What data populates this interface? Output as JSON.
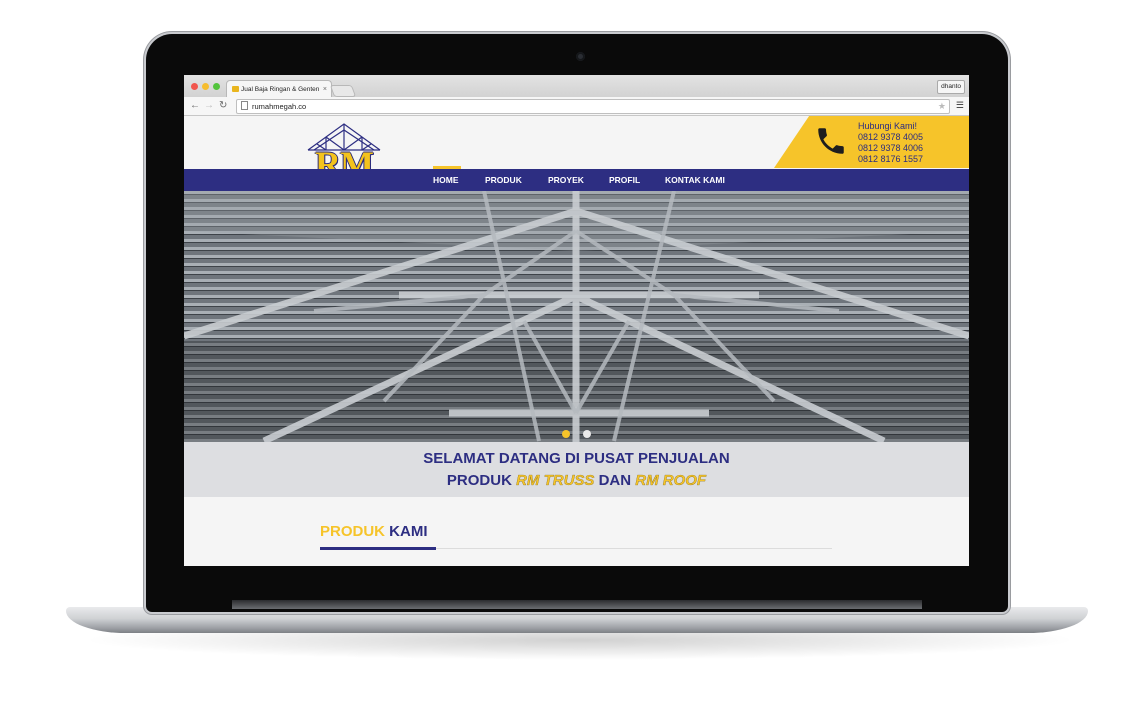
{
  "browser": {
    "tab_title": "Jual Baja Ringan & Genten",
    "url": "rumahmegah.co",
    "user": "dhanto",
    "close_glyph": "×"
  },
  "site": {
    "logo_text": "RM",
    "contact": {
      "heading": "Hubungi Kami!",
      "phones": [
        "0812 9378 4005",
        "0812 9378 4006",
        "0812 8176 1557"
      ]
    },
    "nav": [
      "HOME",
      "PRODUK",
      "PROYEK",
      "PROFIL",
      "KONTAK KAMI"
    ],
    "active_nav": "HOME",
    "slider": {
      "slides": 2,
      "active": 1
    },
    "banner": {
      "line1": "SELAMAT DATANG DI PUSAT PENJUALAN",
      "line2_prefix": "PRODUK ",
      "line2_highlight1": "RM TRUSS",
      "line2_middle": " DAN ",
      "line2_highlight2": "RM ROOF"
    },
    "section": {
      "title_accent": "PRODUK",
      "title_main": " KAMI"
    }
  },
  "colors": {
    "brand_blue": "#2d2e82",
    "brand_yellow": "#f6c42a"
  }
}
